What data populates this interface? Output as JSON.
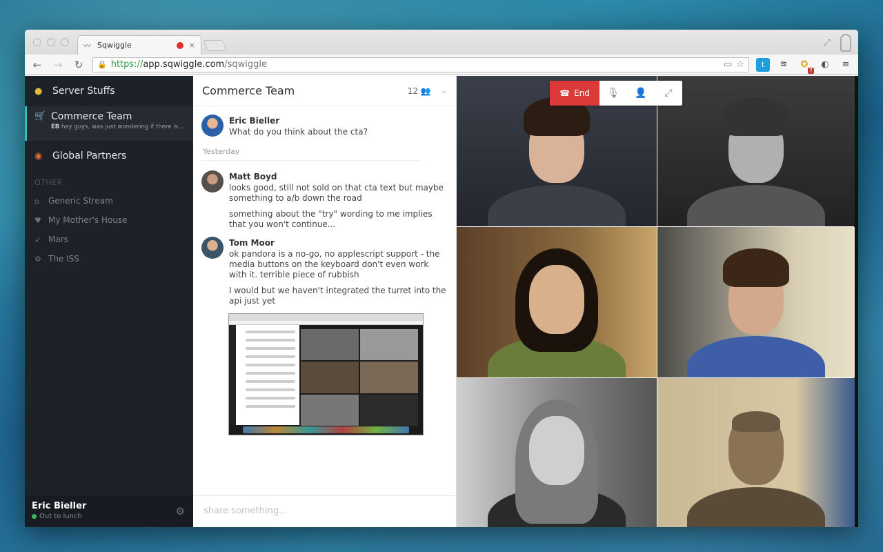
{
  "browser": {
    "tab_title": "Sqwiggle",
    "tab_close": "×",
    "url_scheme": "https://",
    "url_host": "app.sqwiggle.com",
    "url_path": "/sqwiggle",
    "extension_badge": "7"
  },
  "sidebar": {
    "channels": [
      {
        "label": "Server Stuffs",
        "icon": "database-icon"
      },
      {
        "label": "Commerce Team",
        "icon": "cart-icon",
        "preview_initials": "EB",
        "preview_text": "hey guys, was just wondering if there is..."
      },
      {
        "label": "Global Partners",
        "icon": "globe-icon"
      }
    ],
    "section_label": "OTHER",
    "streams": [
      {
        "label": "Generic Stream",
        "icon": "home-icon"
      },
      {
        "label": "My Mother's House",
        "icon": "heart-icon"
      },
      {
        "label": "Mars",
        "icon": "rocket-icon"
      },
      {
        "label": "The ISS",
        "icon": "satellite-icon"
      }
    ],
    "user": {
      "name": "Eric Bieller",
      "status": "Out to lunch"
    }
  },
  "chat": {
    "title": "Commerce Team",
    "member_count": "12",
    "messages": [
      {
        "author": "Eric Bieller",
        "lines": [
          "What do you think about the cta?"
        ]
      },
      {
        "author": "Matt Boyd",
        "lines": [
          "looks good, still not sold on that cta text but maybe something to a/b down the road",
          "something about the \"try\" wording to me implies that you won't continue..."
        ]
      },
      {
        "author": "Tom Moor",
        "lines": [
          "ok pandora is a no-go, no applescript support - the media buttons on the keyboard don't even work with it. terrible piece of rubbish",
          "I would but we haven't integrated the turret into the api just yet"
        ]
      }
    ],
    "day_separator": "Yesterday",
    "composer_placeholder": "share something..."
  },
  "call": {
    "end_label": "End"
  },
  "colors": {
    "accent": "#3fb9b5",
    "end_call": "#dc3a3a",
    "sidebar_bg": "#1d2128"
  }
}
